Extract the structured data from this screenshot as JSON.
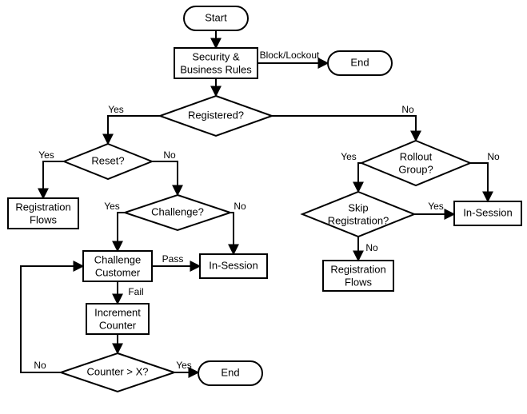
{
  "chart_data": {
    "type": "flowchart",
    "nodes": [
      {
        "id": "start",
        "kind": "terminator",
        "label": "Start"
      },
      {
        "id": "rules",
        "kind": "process",
        "label": "Security &\nBusiness Rules"
      },
      {
        "id": "end1",
        "kind": "terminator",
        "label": "End"
      },
      {
        "id": "registered",
        "kind": "decision",
        "label": "Registered?"
      },
      {
        "id": "reset",
        "kind": "decision",
        "label": "Reset?"
      },
      {
        "id": "regflows1",
        "kind": "process",
        "label": "Registration\nFlows"
      },
      {
        "id": "challengeq",
        "kind": "decision",
        "label": "Challenge?"
      },
      {
        "id": "challengecust",
        "kind": "process",
        "label": "Challenge\nCustomer"
      },
      {
        "id": "insession1",
        "kind": "process",
        "label": "In-Session"
      },
      {
        "id": "inccounter",
        "kind": "process",
        "label": "Increment\nCounter"
      },
      {
        "id": "counterx",
        "kind": "decision",
        "label": "Counter > X?"
      },
      {
        "id": "end2",
        "kind": "terminator",
        "label": "End"
      },
      {
        "id": "rollout",
        "kind": "decision",
        "label": "Rollout\nGroup?"
      },
      {
        "id": "insession2",
        "kind": "process",
        "label": "In-Session"
      },
      {
        "id": "skipreg",
        "kind": "decision",
        "label": "Skip\nRegistration?"
      },
      {
        "id": "regflows2",
        "kind": "process",
        "label": "Registration\nFlows"
      }
    ],
    "edges": [
      {
        "from": "start",
        "to": "rules",
        "label": ""
      },
      {
        "from": "rules",
        "to": "end1",
        "label": "Block/Lockout"
      },
      {
        "from": "rules",
        "to": "registered",
        "label": ""
      },
      {
        "from": "registered",
        "to": "reset",
        "label": "Yes"
      },
      {
        "from": "registered",
        "to": "rollout",
        "label": "No"
      },
      {
        "from": "reset",
        "to": "regflows1",
        "label": "Yes"
      },
      {
        "from": "reset",
        "to": "challengeq",
        "label": "No"
      },
      {
        "from": "challengeq",
        "to": "challengecust",
        "label": "Yes"
      },
      {
        "from": "challengeq",
        "to": "insession1",
        "label": "No"
      },
      {
        "from": "challengecust",
        "to": "insession1",
        "label": "Pass"
      },
      {
        "from": "challengecust",
        "to": "inccounter",
        "label": "Fail"
      },
      {
        "from": "inccounter",
        "to": "counterx",
        "label": ""
      },
      {
        "from": "counterx",
        "to": "end2",
        "label": "Yes"
      },
      {
        "from": "counterx",
        "to": "challengecust",
        "label": "No"
      },
      {
        "from": "rollout",
        "to": "skipreg",
        "label": "Yes"
      },
      {
        "from": "rollout",
        "to": "insession2",
        "label": "No"
      },
      {
        "from": "skipreg",
        "to": "insession2",
        "label": "Yes"
      },
      {
        "from": "skipreg",
        "to": "regflows2",
        "label": "No"
      }
    ]
  },
  "nodes": {
    "start": {
      "l1": "Start"
    },
    "rules": {
      "l1": "Security &",
      "l2": "Business Rules"
    },
    "end1": {
      "l1": "End"
    },
    "registered": {
      "l1": "Registered?"
    },
    "reset": {
      "l1": "Reset?"
    },
    "regflows1": {
      "l1": "Registration",
      "l2": "Flows"
    },
    "challengeq": {
      "l1": "Challenge?"
    },
    "challengecust": {
      "l1": "Challenge",
      "l2": "Customer"
    },
    "insession1": {
      "l1": "In-Session"
    },
    "inccounter": {
      "l1": "Increment",
      "l2": "Counter"
    },
    "counterx": {
      "l1": "Counter > X?"
    },
    "end2": {
      "l1": "End"
    },
    "rollout": {
      "l1": "Rollout",
      "l2": "Group?"
    },
    "insession2": {
      "l1": "In-Session"
    },
    "skipreg": {
      "l1": "Skip",
      "l2": "Registration?"
    },
    "regflows2": {
      "l1": "Registration",
      "l2": "Flows"
    }
  },
  "edges": {
    "rules_end1": "Block/Lockout",
    "reg_yes": "Yes",
    "reg_no": "No",
    "reset_yes": "Yes",
    "reset_no": "No",
    "chq_yes": "Yes",
    "chq_no": "No",
    "cc_pass": "Pass",
    "cc_fail": "Fail",
    "ctr_yes": "Yes",
    "ctr_no": "No",
    "roll_yes": "Yes",
    "roll_no": "No",
    "skip_yes": "Yes",
    "skip_no": "No"
  }
}
